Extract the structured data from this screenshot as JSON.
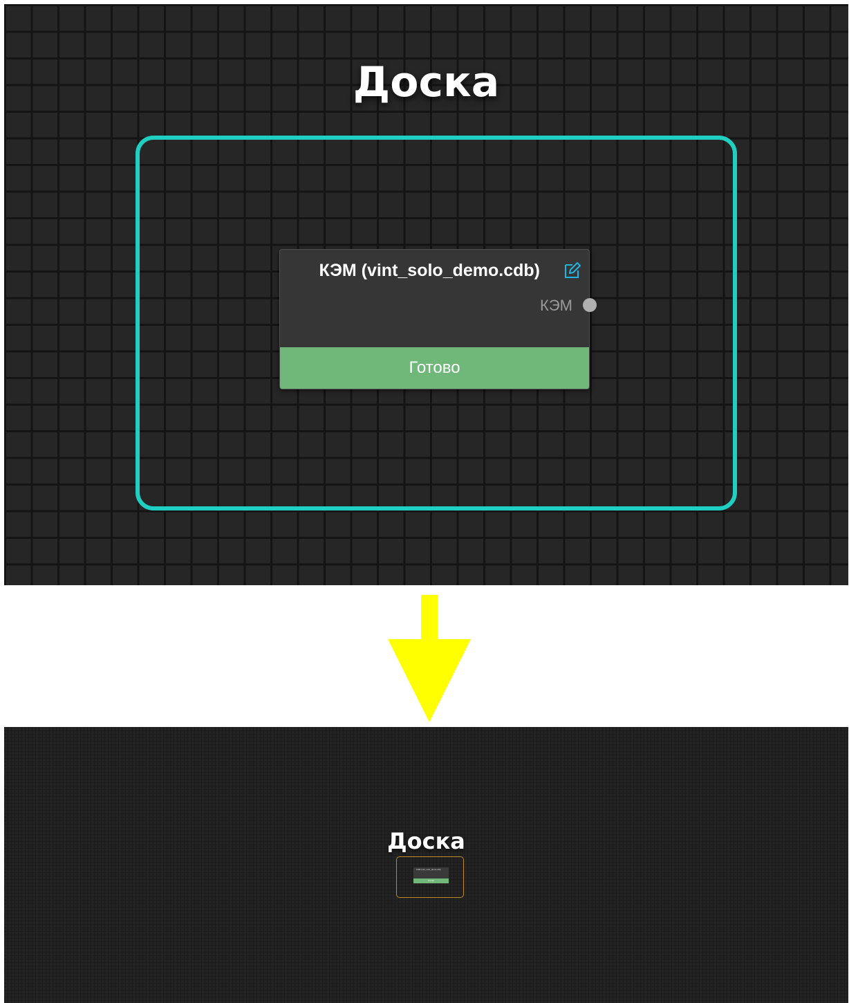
{
  "board": {
    "title": "Доска"
  },
  "node": {
    "title": "КЭМ (vint_solo_demo.cdb)",
    "output_port_label": "КЭМ",
    "status": "Готово",
    "edit_icon": "edit-icon"
  },
  "colors": {
    "group_frame_selected": "#1fcfc1",
    "group_frame_minimap": "#c08a22",
    "status_ready": "#6fb879",
    "arrow": "#ffff00",
    "canvas_bg": "#262626"
  },
  "transition": {
    "arrow_icon": "arrow-down-icon"
  }
}
